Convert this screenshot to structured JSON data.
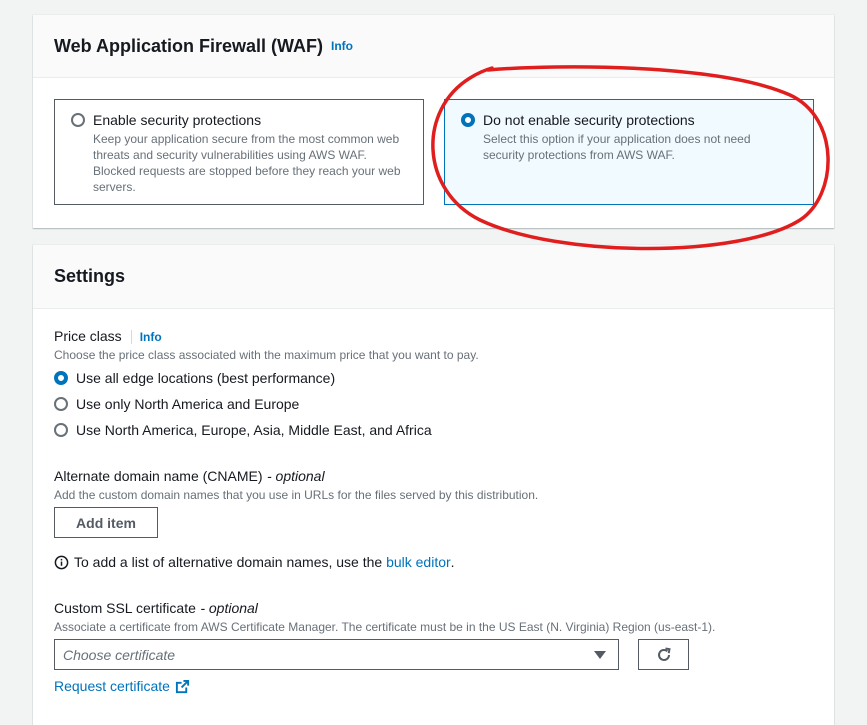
{
  "waf": {
    "title": "Web Application Firewall (WAF)",
    "info": "Info",
    "options": [
      {
        "label": "Enable security protections",
        "description": "Keep your application secure from the most common web threats and security vulnerabilities using AWS WAF. Blocked requests are stopped before they reach your web servers.",
        "selected": false
      },
      {
        "label": "Do not enable security protections",
        "description": "Select this option if your application does not need security protections from AWS WAF.",
        "selected": true
      }
    ]
  },
  "settings": {
    "title": "Settings",
    "price_class": {
      "label": "Price class",
      "info": "Info",
      "description": "Choose the price class associated with the maximum price that you want to pay.",
      "options": [
        {
          "label": "Use all edge locations (best performance)",
          "selected": true
        },
        {
          "label": "Use only North America and Europe",
          "selected": false
        },
        {
          "label": "Use North America, Europe, Asia, Middle East, and Africa",
          "selected": false
        }
      ]
    },
    "cname": {
      "label": "Alternate domain name (CNAME)",
      "optional": "- optional",
      "description": "Add the custom domain names that you use in URLs for the files served by this distribution.",
      "add_button": "Add item",
      "hint_prefix": "To add a list of alternative domain names, use the",
      "hint_link": "bulk editor",
      "hint_suffix": "."
    },
    "ssl": {
      "label": "Custom SSL certificate",
      "optional": "- optional",
      "description": "Associate a certificate from AWS Certificate Manager. The certificate must be in the US East (N. Virginia) Region (us-east-1).",
      "placeholder": "Choose certificate",
      "request_link": "Request certificate"
    }
  },
  "colors": {
    "accent": "#0073bb",
    "annotation": "#e01e1e",
    "selected_tile_bg": "#f1faff"
  }
}
